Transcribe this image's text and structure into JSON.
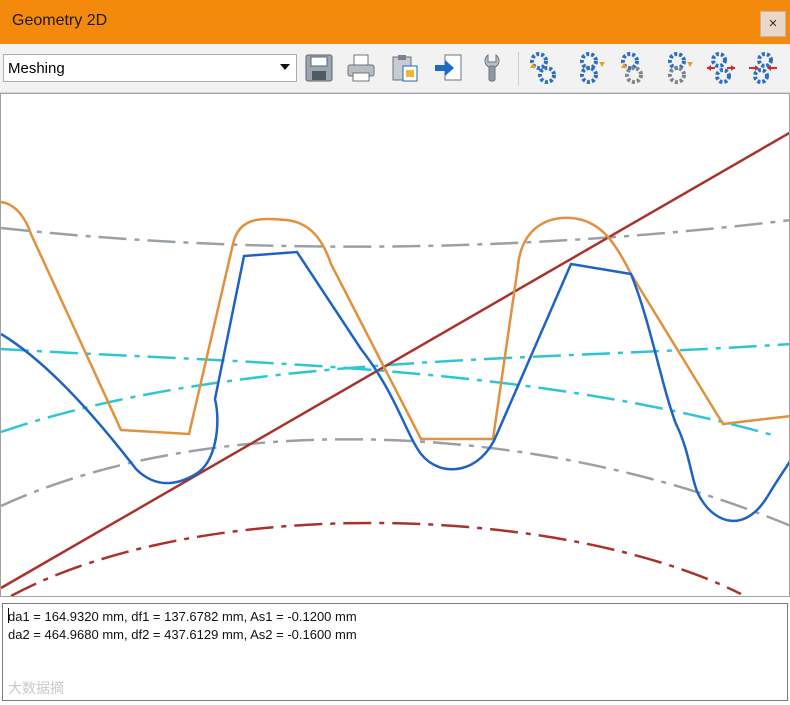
{
  "window": {
    "title": "Geometry 2D",
    "close_glyph": "×"
  },
  "toolbar": {
    "view_select": {
      "value": "Meshing",
      "options": [
        "Meshing"
      ]
    },
    "buttons": [
      {
        "name": "save-icon"
      },
      {
        "name": "print-icon"
      },
      {
        "name": "clipboard-icon"
      },
      {
        "name": "export-icon"
      },
      {
        "name": "settings-wrench-icon"
      },
      {
        "name": "gears-up-blue-icon"
      },
      {
        "name": "gears-down-blue-icon"
      },
      {
        "name": "gears-up-gray-icon"
      },
      {
        "name": "gears-down-gray-icon"
      },
      {
        "name": "gears-spread-icon"
      },
      {
        "name": "gears-contract-icon"
      }
    ]
  },
  "canvas": {
    "colors": {
      "gear1_outline": "#1e63c4",
      "gear2_outline": "#e1913d",
      "pitch_lines": "#2ec5d6",
      "tip_root_lines": "#9aa1a6",
      "line_of_action": "#a8332b",
      "base_circle": "#a8332b"
    }
  },
  "output": {
    "line1": "da1 = 164.9320 mm, df1 = 137.6782 mm, As1 = -0.1200 mm",
    "line2": "da2 = 464.9680 mm, df2 = 437.6129 mm, As2 = -0.1600 mm"
  },
  "watermark": "大数据摘"
}
